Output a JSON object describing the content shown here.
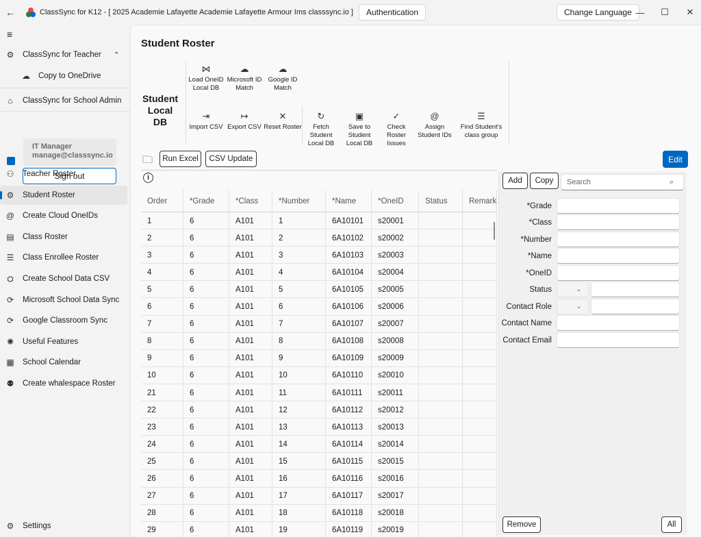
{
  "window": {
    "title": "ClassSync for K12 - [ 2025 Academie Lafayette Academie Lafayette Armour Ims classsync.io ]",
    "auth_button": "Authentication",
    "change_language": "Change Language",
    "minimize": "—",
    "maximize": "☐",
    "close": "✕"
  },
  "sidebar": {
    "menu_icon": "hamburger-icon",
    "teacher_section": "ClassSync for Teacher",
    "copy_onedrive": "Copy to OneDrive",
    "admin_section": "ClassSync for School Admin",
    "user_name": "IT Manager",
    "user_email": "manage@classsync.io",
    "sign_out": "Sign out",
    "settings": "Settings",
    "items": [
      {
        "label": "Teacher Roster",
        "icon": "person-roster-icon"
      },
      {
        "label": "Student Roster",
        "icon": "gear-person-icon",
        "active": true
      },
      {
        "label": "Create Cloud OneIDs",
        "icon": "at-icon"
      },
      {
        "label": "Class Roster",
        "icon": "clipboard-icon"
      },
      {
        "label": "Class Enrollee Roster",
        "icon": "list-icon"
      },
      {
        "label": "Create School Data CSV",
        "icon": "data-icon"
      },
      {
        "label": "Microsoft School Data Sync",
        "icon": "sync-icon"
      },
      {
        "label": "Google Classroom Sync",
        "icon": "sync-icon"
      },
      {
        "label": "Useful Features",
        "icon": "sparkle-icon"
      },
      {
        "label": "School Calendar",
        "icon": "calendar-icon"
      },
      {
        "label": "Create whalespace Roster",
        "icon": "person-gear-icon"
      }
    ]
  },
  "main": {
    "title": "Student Roster",
    "local_db_label": "Student Local DB",
    "ribbon": {
      "load_oneid": "Load OneID Local DB",
      "ms_match": "Microsoft ID Match",
      "google_match": "Google ID Match",
      "import_csv": "Import CSV",
      "export_csv": "Export CSV",
      "reset_roster": "Reset Roster",
      "fetch_student": "Fetch Student Local DB",
      "save_student": "Save to Student Local DB",
      "check_issues": "Check Roster Issues",
      "assign_ids": "Assign Student IDs",
      "find_group": "Find Student's class group"
    },
    "run_excel": "Run Excel",
    "csv_update": "CSV Update",
    "edit": "Edit",
    "info_icon": "i"
  },
  "table": {
    "columns": [
      "Order",
      "*Grade",
      "*Class",
      "*Number",
      "*Name",
      "*OneID",
      "Status",
      "Remarks"
    ],
    "rows": [
      [
        "1",
        "6",
        "A101",
        "1",
        "6A10101",
        "s20001"
      ],
      [
        "2",
        "6",
        "A101",
        "2",
        "6A10102",
        "s20002"
      ],
      [
        "3",
        "6",
        "A101",
        "3",
        "6A10103",
        "s20003"
      ],
      [
        "4",
        "6",
        "A101",
        "4",
        "6A10104",
        "s20004"
      ],
      [
        "5",
        "6",
        "A101",
        "5",
        "6A10105",
        "s20005"
      ],
      [
        "6",
        "6",
        "A101",
        "6",
        "6A10106",
        "s20006"
      ],
      [
        "7",
        "6",
        "A101",
        "7",
        "6A10107",
        "s20007"
      ],
      [
        "8",
        "6",
        "A101",
        "8",
        "6A10108",
        "s20008"
      ],
      [
        "9",
        "6",
        "A101",
        "9",
        "6A10109",
        "s20009"
      ],
      [
        "10",
        "6",
        "A101",
        "10",
        "6A10110",
        "s20010"
      ],
      [
        "21",
        "6",
        "A101",
        "11",
        "6A10111",
        "s20011"
      ],
      [
        "22",
        "6",
        "A101",
        "12",
        "6A10112",
        "s20012"
      ],
      [
        "23",
        "6",
        "A101",
        "13",
        "6A10113",
        "s20013"
      ],
      [
        "24",
        "6",
        "A101",
        "14",
        "6A10114",
        "s20014"
      ],
      [
        "25",
        "6",
        "A101",
        "15",
        "6A10115",
        "s20015"
      ],
      [
        "26",
        "6",
        "A101",
        "16",
        "6A10116",
        "s20016"
      ],
      [
        "27",
        "6",
        "A101",
        "17",
        "6A10117",
        "s20017"
      ],
      [
        "28",
        "6",
        "A101",
        "18",
        "6A10118",
        "s20018"
      ],
      [
        "29",
        "6",
        "A101",
        "19",
        "6A10119",
        "s20019"
      ]
    ]
  },
  "panel": {
    "add": "Add",
    "copy": "Copy",
    "search_placeholder": "Search",
    "fields": {
      "grade": "*Grade",
      "class": "*Class",
      "number": "*Number",
      "name": "*Name",
      "oneid": "*OneID",
      "status": "Status",
      "contact_role": "Contact Role",
      "contact_name": "Contact Name",
      "contact_email": "Contact Email"
    },
    "remove": "Remove",
    "all": "All"
  },
  "colors": {
    "accent": "#0067c0"
  }
}
